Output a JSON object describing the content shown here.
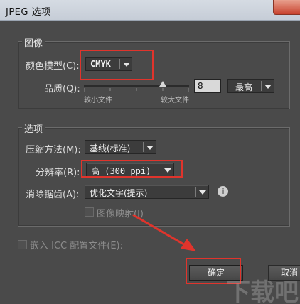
{
  "window": {
    "title": "JPEG 选项"
  },
  "image_section": {
    "legend": "图像",
    "color_model_label": "颜色模型(C):",
    "color_model_value": "CMYK",
    "quality_label": "品质(Q):",
    "quality_value": "8",
    "quality_preset": "最高",
    "slider_min_label": "较小文件",
    "slider_max_label": "较大文件",
    "slider_position": 0.75
  },
  "options_section": {
    "legend": "选项",
    "compression_label": "压缩方法(M):",
    "compression_value": "基线(标准)",
    "resolution_label": "分辨率(R):",
    "resolution_value": "高 (300 ppi)",
    "antialias_label": "消除锯齿(A):",
    "antialias_value": "优化文字(提示)",
    "image_map_label": "图像映射(I)"
  },
  "embed_icc_label": "嵌入 ICC 配置文件(E):",
  "buttons": {
    "ok_label": "确定",
    "cancel_label": "取消"
  },
  "watermark_text": "下载吧",
  "colors": {
    "highlight_red": "#e0342c",
    "dialog_bg": "#4a4a4a"
  }
}
